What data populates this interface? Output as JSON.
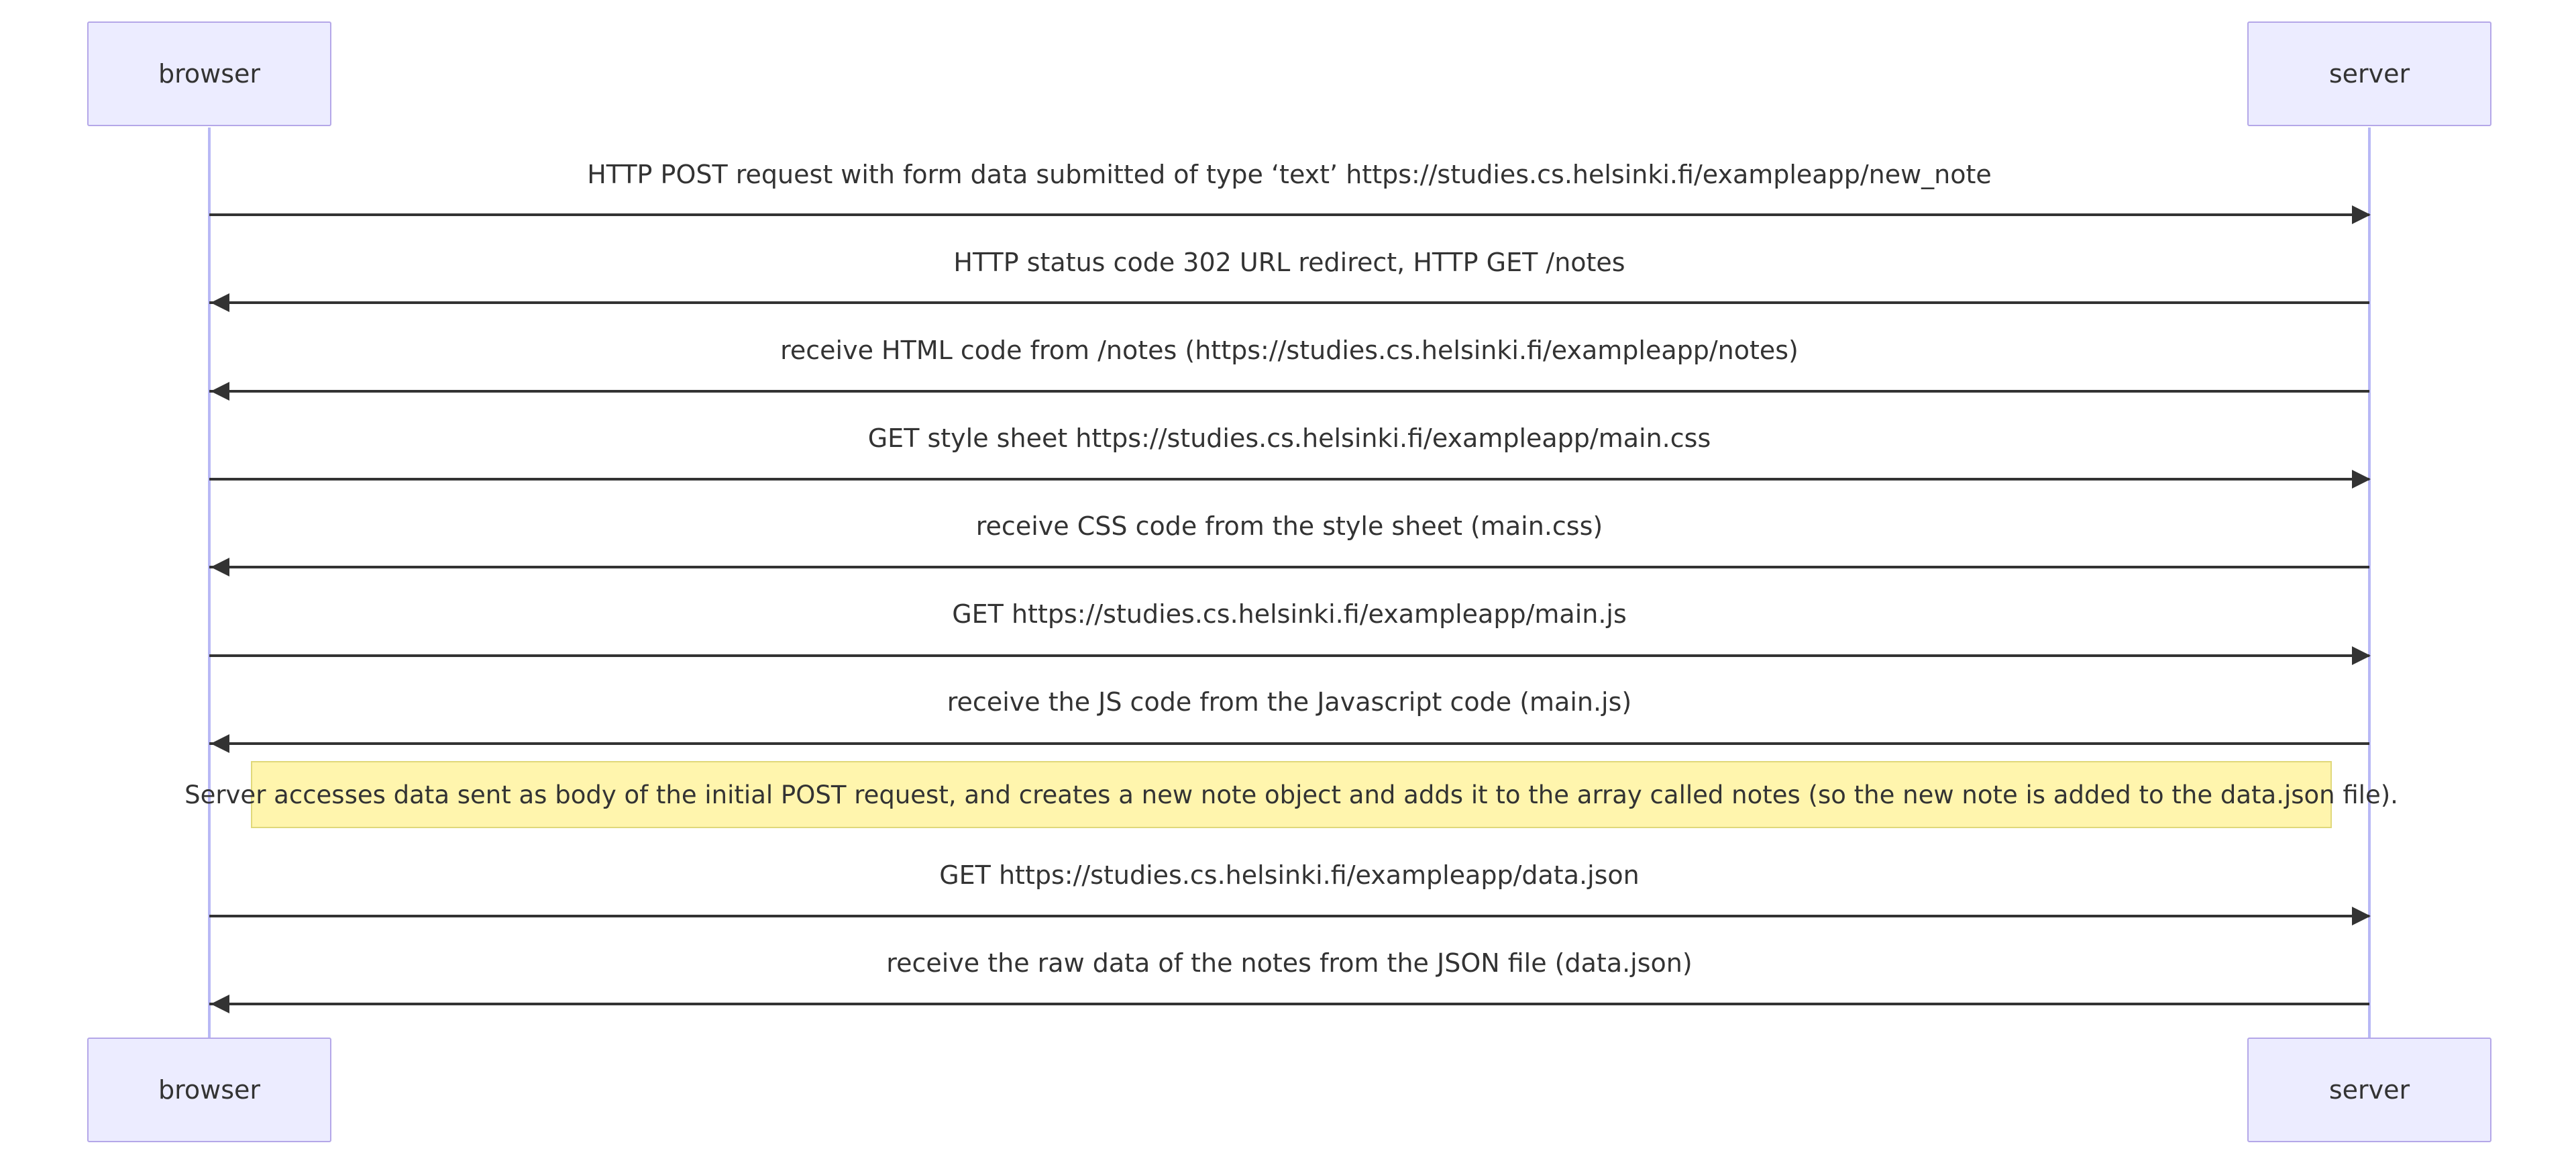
{
  "actors": {
    "left": "browser",
    "right": "server"
  },
  "colors": {
    "actor_fill": "#ececff",
    "actor_border": "#b4a7e8",
    "lifeline": "#b8b8f5",
    "arrow": "#333333",
    "note_fill": "#fff5ad",
    "note_border": "#e0d87a",
    "text": "#333333"
  },
  "messages": [
    {
      "label": "HTTP POST request with form data submitted of type ‘text’ https://studies.cs.helsinki.fi/exampleapp/new_note",
      "direction": "to_right"
    },
    {
      "label": "HTTP status code 302 URL redirect, HTTP GET /notes",
      "direction": "to_left"
    },
    {
      "label": "receive HTML code from /notes (https://studies.cs.helsinki.fi/exampleapp/notes)",
      "direction": "to_left"
    },
    {
      "label": "GET style sheet https://studies.cs.helsinki.fi/exampleapp/main.css",
      "direction": "to_right"
    },
    {
      "label": "receive CSS code from the style sheet (main.css)",
      "direction": "to_left"
    },
    {
      "label": "GET https://studies.cs.helsinki.fi/exampleapp/main.js",
      "direction": "to_right"
    },
    {
      "label": "receive the JS code from the Javascript code (main.js)",
      "direction": "to_left"
    },
    {
      "label": "GET https://studies.cs.helsinki.fi/exampleapp/data.json",
      "direction": "to_right"
    },
    {
      "label": "receive the raw data of the notes from the JSON file (data.json)",
      "direction": "to_left"
    }
  ],
  "note": "Server accesses data sent as body of the initial POST request, and creates a new note object and adds it to the array called notes (so the new note is added to the data.json file)."
}
